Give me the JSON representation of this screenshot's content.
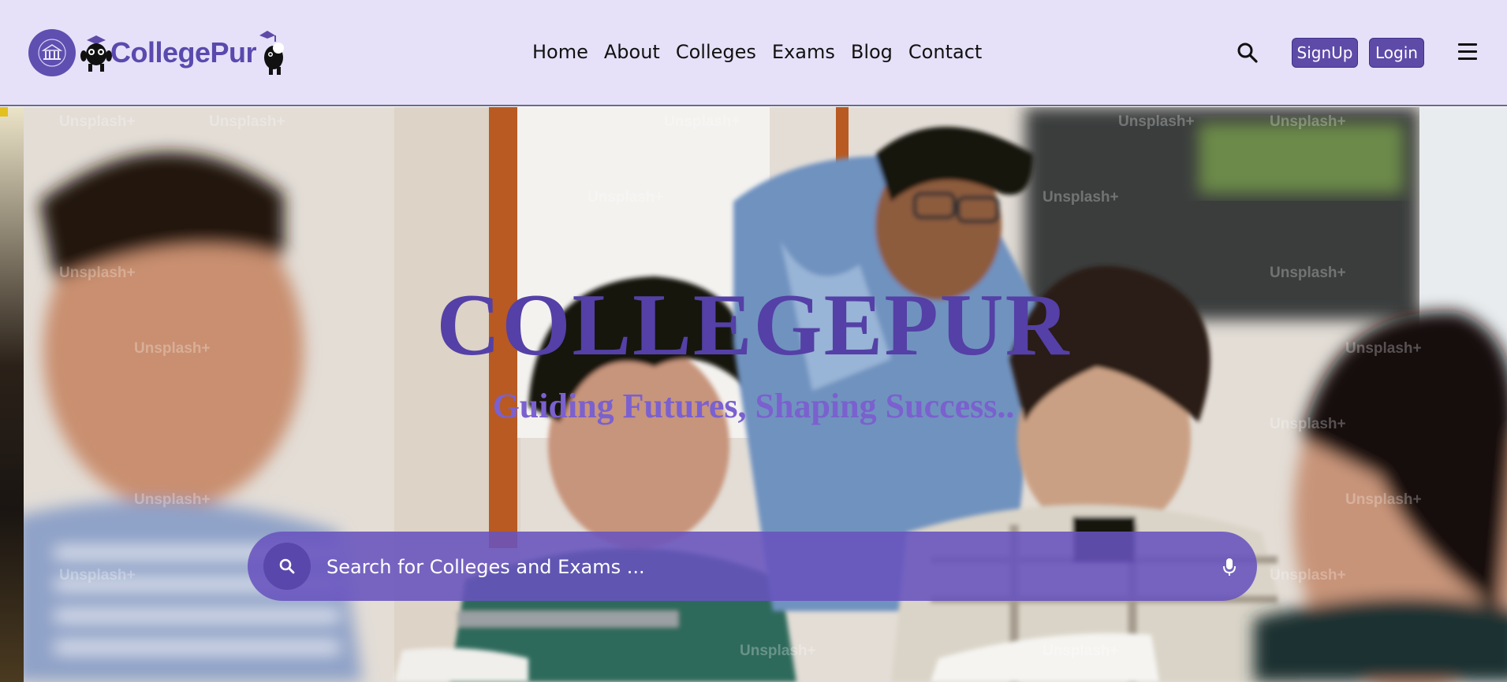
{
  "brand": {
    "name": "CollegePur"
  },
  "nav": {
    "items": [
      "Home",
      "About",
      "Colleges",
      "Exams",
      "Blog",
      "Contact"
    ]
  },
  "header": {
    "signup_label": "SignUp",
    "login_label": "Login"
  },
  "hero": {
    "title": "COLLEGEPUR",
    "subtitle": "Guiding Futures, Shaping Success..",
    "search_placeholder": "Search for Colleges and Exams ...",
    "watermark": "Unsplash+"
  },
  "icons": {
    "header_search": "search-icon",
    "menu": "hamburger-menu-icon",
    "hero_search": "search-icon",
    "mic": "microphone-icon"
  },
  "colors": {
    "header_bg": "#e6e1f8",
    "brand_purple": "#5e4ba8",
    "title_purple": "#5440a6",
    "subtitle_purple": "#7b60cf",
    "searchbar": "#6853be"
  }
}
